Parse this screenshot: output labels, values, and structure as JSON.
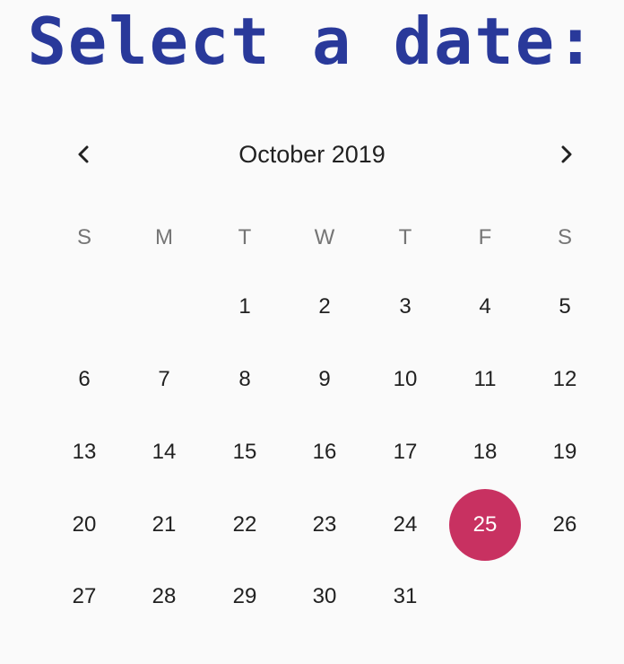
{
  "title": "Select a date:",
  "calendar": {
    "month_label": "October 2019",
    "prev_icon": "chevron-left-icon",
    "next_icon": "chevron-right-icon",
    "weekdays": [
      "S",
      "M",
      "T",
      "W",
      "T",
      "F",
      "S"
    ],
    "selected_day": "25",
    "selected_color": "#c83161",
    "title_color": "#29399a",
    "weeks": [
      [
        "",
        "",
        "1",
        "2",
        "3",
        "4",
        "5"
      ],
      [
        "6",
        "7",
        "8",
        "9",
        "10",
        "11",
        "12"
      ],
      [
        "13",
        "14",
        "15",
        "16",
        "17",
        "18",
        "19"
      ],
      [
        "20",
        "21",
        "22",
        "23",
        "24",
        "25",
        "26"
      ],
      [
        "27",
        "28",
        "29",
        "30",
        "31",
        "",
        ""
      ]
    ]
  }
}
